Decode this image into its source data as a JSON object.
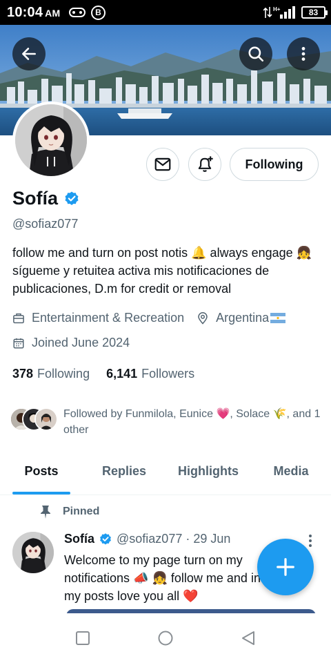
{
  "status_bar": {
    "time": "10:04",
    "ampm": "AM",
    "b_icon_label": "B",
    "network": "H+",
    "battery": "83"
  },
  "profile": {
    "display_name": "Sofía",
    "handle": "@sofiaz077",
    "bio": "follow me and turn on post notis 🔔  always engage 👧 sígueme y retuitea activa mis notificaciones de publicaciones, D.m for credit or removal",
    "category": "Entertainment & Recreation",
    "location": "Argentina",
    "joined": "Joined June 2024",
    "following_count": "378",
    "following_label": "Following",
    "followers_count": "6,141",
    "followers_label": "Followers",
    "followed_by": "Followed by Funmilola, Eunice 💗, Solace 🌾, and 1 other"
  },
  "actions": {
    "follow_state_label": "Following"
  },
  "tabs": [
    {
      "label": "Posts",
      "active": true
    },
    {
      "label": "Replies",
      "active": false
    },
    {
      "label": "Highlights",
      "active": false
    },
    {
      "label": "Media",
      "active": false
    }
  ],
  "pinned_post": {
    "pinned_label": "Pinned",
    "author_name": "Sofía",
    "author_handle": "@sofiaz077",
    "separator": "·",
    "date": "29 Jun",
    "text": "Welcome to my page  turn on my notifications 📣 👧 follow me and in my posts love you all ❤️"
  },
  "colors": {
    "accent": "#1d9bf0",
    "text_primary": "#0f1419",
    "text_secondary": "#536471",
    "border": "#cfd9de"
  },
  "icons": {
    "back": "arrow-left-icon",
    "search": "search-icon",
    "more": "more-vertical-icon",
    "message": "envelope-icon",
    "notify": "bell-plus-icon",
    "verified": "verified-badge-icon",
    "category": "briefcase-icon",
    "location": "location-pin-icon",
    "joined": "calendar-icon",
    "pin": "pin-icon",
    "compose": "plus-icon"
  }
}
